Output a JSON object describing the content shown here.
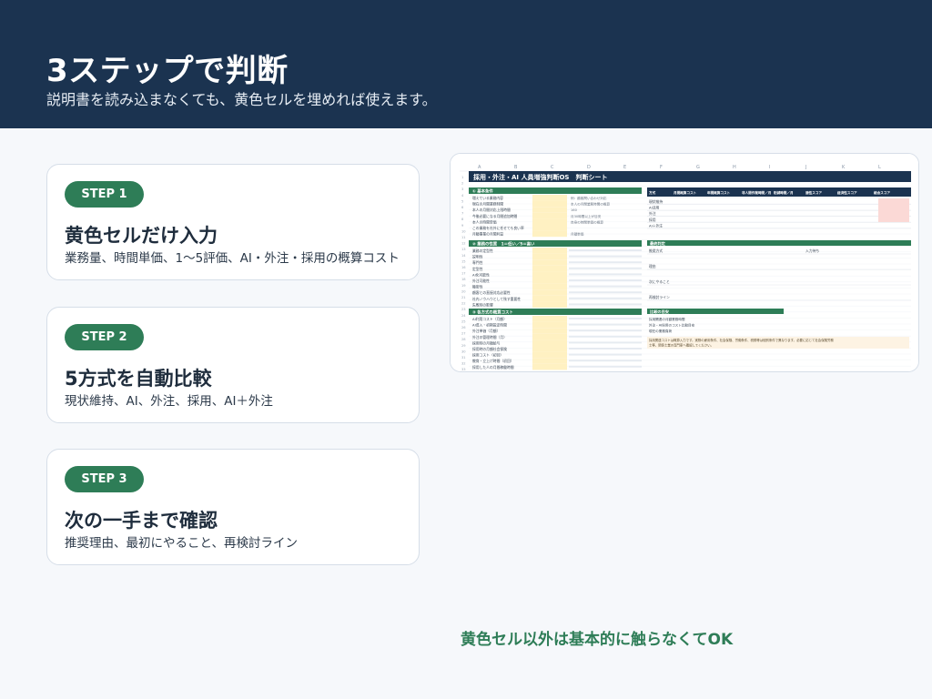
{
  "header": {
    "title": "3ステップで判断",
    "subtitle": "説明書を読み込まなくても、黄色セルを埋めれば使えます。"
  },
  "steps": [
    {
      "label": "STEP 1",
      "title": "黄色セルだけ入力",
      "desc": "業務量、時間単価、1〜5評価、AI・外注・採用の概算コスト"
    },
    {
      "label": "STEP 2",
      "title": "5方式を自動比較",
      "desc": "現状維持、AI、外注、採用、AI＋外注"
    },
    {
      "label": "STEP 3",
      "title": "次の一手まで確認",
      "desc": "推奨理由、最初にやること、再検討ライン"
    }
  ],
  "sheet": {
    "title": "採用・外注・AI 人員増強判断OS　判断シート",
    "columns": [
      "A",
      "B",
      "C",
      "D",
      "E",
      "F",
      "G",
      "H",
      "I",
      "J",
      "K",
      "L"
    ],
    "sections": {
      "basic": "① 基本条件",
      "nature": "② 業務の性質　1＝低い／5＝高い",
      "cost": "③ 各方式の概算コスト",
      "judge": "最終判定",
      "compare": "比較の目安"
    },
    "compare_headers": [
      "方式",
      "月間概算コスト",
      "年間概算コスト",
      "非人間作業時間／月",
      "削減時間／月",
      "適性スコア",
      "経済性スコア",
      "総合スコア"
    ],
    "methods": [
      "現状維持",
      "AI活用",
      "外注",
      "採用",
      "AI＋外注"
    ],
    "judge_rows": [
      "推奨方式",
      "理由",
      "次にやること",
      "再検討ライン"
    ],
    "judge_input": "入力待ち",
    "compare_rows": [
      "採用関連の月額業務時間",
      "外注・AI採用のコスト比較目安",
      "現在の業務負荷"
    ],
    "note": "採用関連コストは概算入力です。実際の雇用条件、社会保険、労働条件、税務等は個別条件で異なります。必要に応じて社会保険労務士等、関係士業の専門家へ確認してください。",
    "basic_rows": [
      "増えている業務内容",
      "現在の月間業務時間",
      "本人の月間対応上限時間",
      "今後必要になる月間追加時間",
      "本人の時間単価",
      "この業務を社外に任せても良い率",
      "月額事業の月間利益"
    ],
    "basic_hints": [
      "例：顧客問い合わせ対応",
      "本人の月間業務時間の概算",
      "160",
      "月30時間以上が目安",
      "自身の時間単価の概算",
      "",
      "月額単価"
    ],
    "nature_rows": [
      "業務の定型性",
      "説明性",
      "専門性",
      "定型性",
      "AI化可能性",
      "外注可能性",
      "機密性",
      "顧客との直接対応必要性",
      "社内ノウハウとして残す重要性",
      "失敗時の影響"
    ],
    "cost_rows": [
      "AI利用コスト（月額）",
      "AI導入・初期設定時間",
      "外注単価（月額）",
      "外注の管理時間（月）",
      "採用時の月額給与",
      "採用時の月額社会保険",
      "採用コスト（初回）",
      "教育・立上げ時間（初回）",
      "採用した人の月間稼働時間"
    ]
  },
  "colors": {
    "header_bg": "#1b3350",
    "accent_green": "#2e7d57",
    "sheet_header": "#1b3350",
    "input_yellow": "#fff1c2",
    "score_pink": "#fbd9d6"
  },
  "footer": {
    "note": "黄色セル以外は基本的に触らなくてOK"
  }
}
